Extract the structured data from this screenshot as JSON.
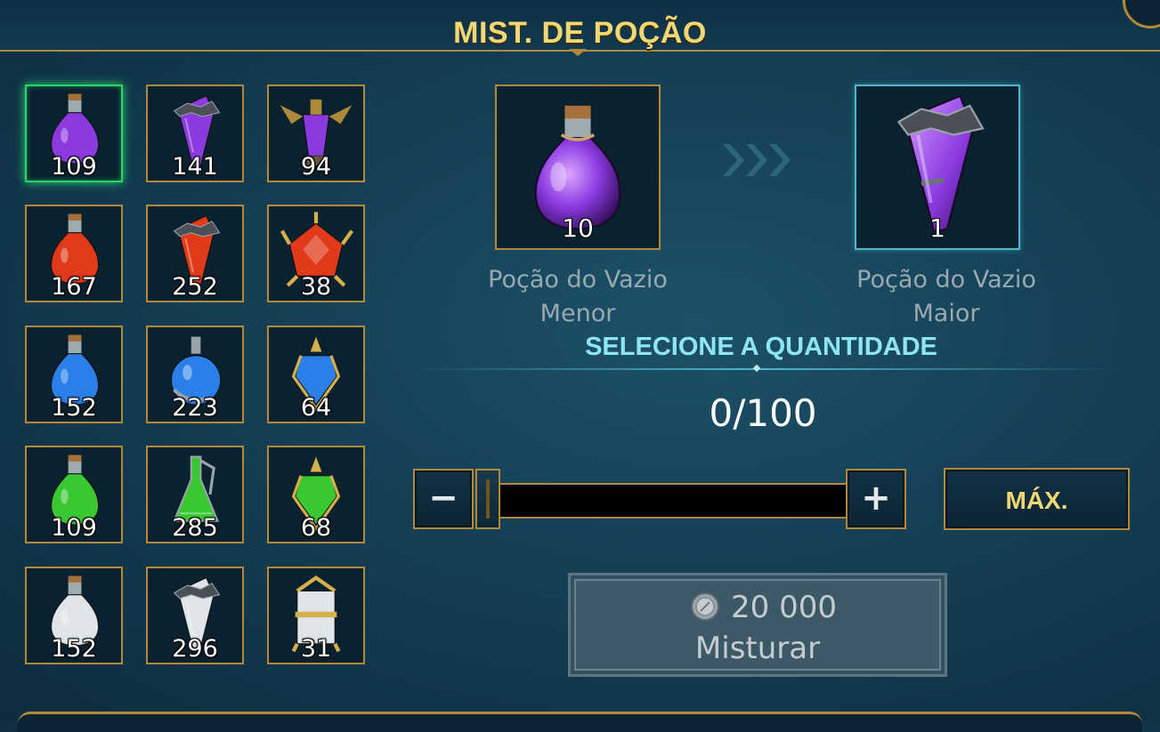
{
  "header": {
    "title": "MIST. DE POÇÃO"
  },
  "inventory": [
    {
      "icon": "purple-flask-icon",
      "count": "109",
      "color": "#8b3ae0",
      "selected": true
    },
    {
      "icon": "purple-crystal-vial-icon",
      "count": "141",
      "color": "#8b3ae0"
    },
    {
      "icon": "purple-winged-vial-icon",
      "count": "94",
      "color": "#8b3ae0"
    },
    {
      "icon": "red-flask-icon",
      "count": "167",
      "color": "#e03a1a"
    },
    {
      "icon": "red-crystal-vial-icon",
      "count": "252",
      "color": "#e03a1a"
    },
    {
      "icon": "red-spiked-gem-icon",
      "count": "38",
      "color": "#e03a1a"
    },
    {
      "icon": "blue-flask-icon",
      "count": "152",
      "color": "#2a7fe8"
    },
    {
      "icon": "blue-round-vial-icon",
      "count": "223",
      "color": "#2a7fe8"
    },
    {
      "icon": "blue-ornate-vial-icon",
      "count": "64",
      "color": "#2a7fe8"
    },
    {
      "icon": "green-flask-icon",
      "count": "109",
      "color": "#3ac832"
    },
    {
      "icon": "green-decanter-icon",
      "count": "285",
      "color": "#3ac832"
    },
    {
      "icon": "green-ornate-vial-icon",
      "count": "68",
      "color": "#3ac832"
    },
    {
      "icon": "white-flask-icon",
      "count": "152",
      "color": "#dfe5e8"
    },
    {
      "icon": "white-crystal-vial-icon",
      "count": "296",
      "color": "#dfe5e8"
    },
    {
      "icon": "white-lantern-vial-icon",
      "count": "31",
      "color": "#dfe5e8"
    }
  ],
  "recipe": {
    "input": {
      "icon": "purple-flask-icon",
      "count": "10",
      "name_line1": "Poção do Vazio",
      "name_line2": "Menor"
    },
    "output": {
      "icon": "purple-crystal-vial-icon",
      "count": "1",
      "name_line1": "Poção do Vazio",
      "name_line2": "Maior"
    },
    "arrows_icon": "chevrons-right-icon"
  },
  "quantity": {
    "label": "SELECIONE A QUANTIDADE",
    "value": "0/100",
    "minus": "−",
    "plus": "+",
    "max_label": "MÁX.",
    "slider_fraction": 0
  },
  "mix": {
    "coin_icon": "silver-coin-icon",
    "cost": "20 000",
    "label": "Misturar"
  },
  "colors": {
    "gold": "#b08a3a",
    "title": "#f2d774",
    "selected": "#2bd46a",
    "accent_cyan": "#8ee6f2"
  }
}
